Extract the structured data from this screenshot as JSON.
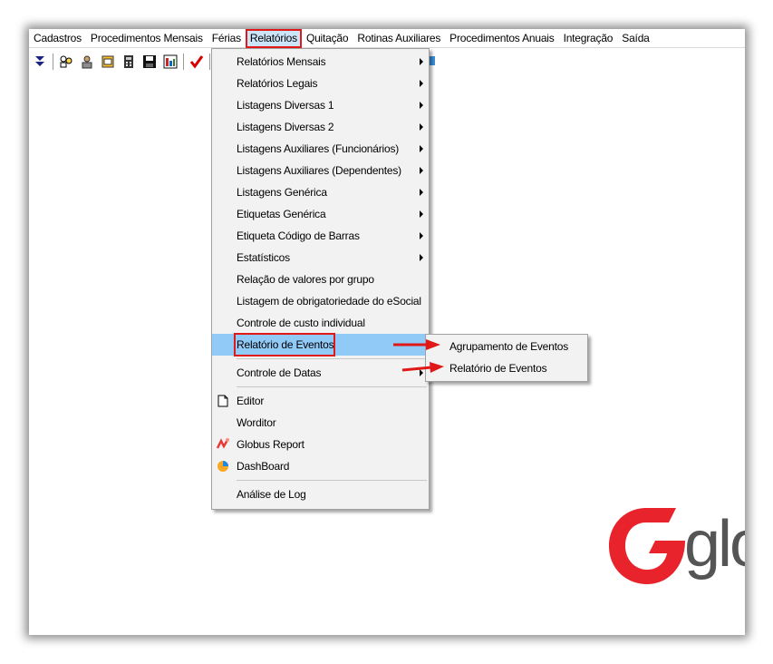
{
  "menubar": {
    "items": [
      "Cadastros",
      "Procedimentos Mensais",
      "Férias",
      "Relatórios",
      "Quitação",
      "Rotinas Auxiliares",
      "Procedimentos Anuais",
      "Integração",
      "Saída"
    ],
    "active_index": 3
  },
  "dropdown": {
    "items": [
      {
        "label": "Relatórios Mensais",
        "submenu": true
      },
      {
        "label": "Relatórios Legais",
        "submenu": true
      },
      {
        "label": "Listagens Diversas 1",
        "submenu": true
      },
      {
        "label": "Listagens Diversas 2",
        "submenu": true
      },
      {
        "label": "Listagens Auxiliares (Funcionários)",
        "submenu": true
      },
      {
        "label": "Listagens Auxiliares (Dependentes)",
        "submenu": true
      },
      {
        "label": "Listagens Genérica",
        "submenu": true
      },
      {
        "label": "Etiquetas Genérica",
        "submenu": true
      },
      {
        "label": "Etiqueta Código de Barras",
        "submenu": true
      },
      {
        "label": "Estatísticos",
        "submenu": true
      },
      {
        "label": "Relação de valores por grupo",
        "submenu": false
      },
      {
        "label": "Listagem de obrigatoriedade do eSocial",
        "submenu": false
      },
      {
        "label": "Controle de custo individual",
        "submenu": false
      },
      {
        "label": "Relatório de Eventos",
        "submenu": true,
        "highlighted": true
      },
      {
        "label": "Controle de Datas",
        "submenu": true
      },
      {
        "label": "Editor",
        "icon": "document-icon"
      },
      {
        "label": "Worditor"
      },
      {
        "label": "Globus Report",
        "icon": "globus-report-icon"
      },
      {
        "label": "DashBoard",
        "icon": "pie-chart-icon"
      },
      {
        "label": "Análise de Log"
      }
    ]
  },
  "submenu": {
    "items": [
      "Agrupamento de Eventos",
      "Relatório de Eventos"
    ]
  },
  "logo": {
    "text": "glo",
    "brand_color": "#e8232c",
    "text_color": "#555555"
  },
  "colors": {
    "highlight": "#91c9f7",
    "annotation_red": "#e01818",
    "menu_bg": "#f2f2f2"
  }
}
